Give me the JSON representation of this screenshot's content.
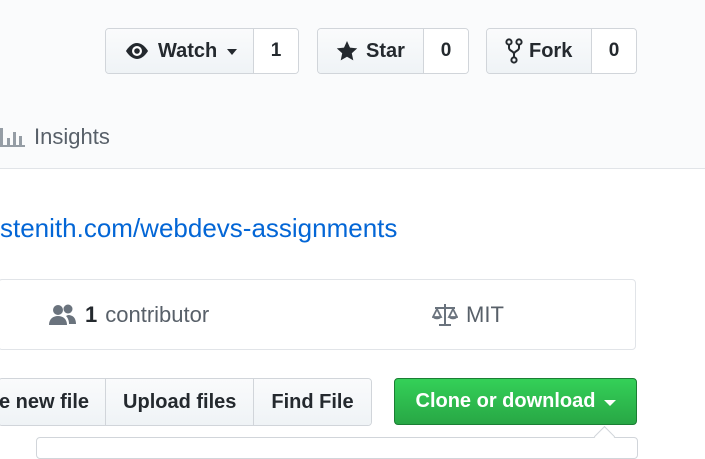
{
  "repo_actions": {
    "watch": {
      "label": "Watch",
      "count": "1",
      "icon": "eye-icon"
    },
    "star": {
      "label": "Star",
      "count": "0",
      "icon": "star-icon"
    },
    "fork": {
      "label": "Fork",
      "count": "0",
      "icon": "fork-icon"
    }
  },
  "nav": {
    "insights_label": "Insights",
    "insights_icon": "graph-icon"
  },
  "repo": {
    "homepage_link": "stenith.com/webdevs-assignments"
  },
  "summary": {
    "contributors_count": "1",
    "contributors_label": "contributor",
    "contributors_icon": "people-icon",
    "license_label": "MIT",
    "license_icon": "law-icon"
  },
  "file_actions": {
    "create_new_file_label": "e new file",
    "upload_files_label": "Upload files",
    "find_file_label": "Find File",
    "clone_label": "Clone or download"
  },
  "colors": {
    "link": "#0366d6",
    "clone_green": "#28a745",
    "muted_text": "#586069"
  }
}
